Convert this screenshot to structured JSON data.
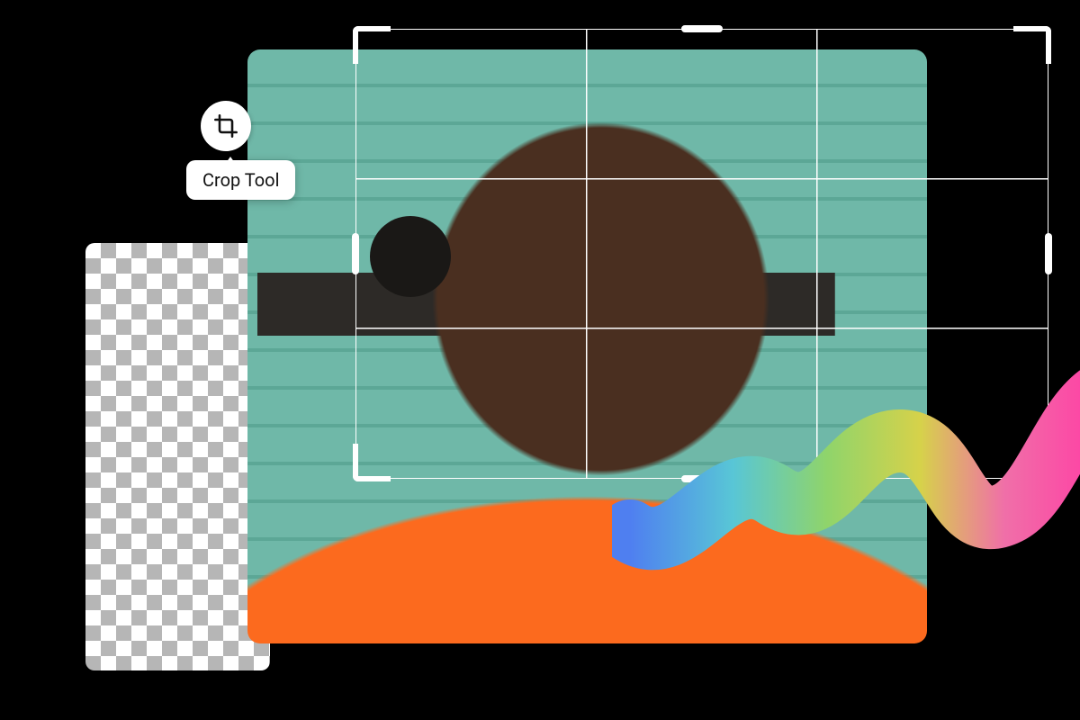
{
  "tool": {
    "icon": "crop-icon",
    "label": "Crop Tool"
  },
  "panels": {
    "transparency": "checkerboard",
    "stroke_gradient": [
      "#4f7ff0",
      "#58c6d6",
      "#8fd46b",
      "#d6d24a",
      "#f06fa8",
      "#ff3fa4"
    ]
  }
}
